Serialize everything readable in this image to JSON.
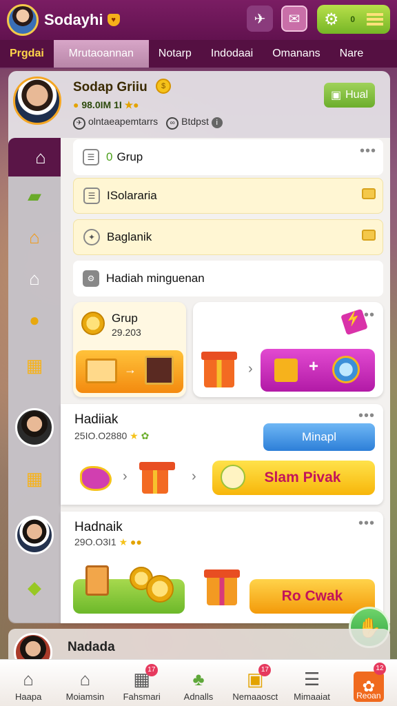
{
  "header": {
    "app_title": "Sodayhi",
    "settings_count": "0"
  },
  "tabs": [
    "Prgdai",
    "Mrutaoannan",
    "Notarp",
    "Indodaai",
    "Omanans",
    "Nare"
  ],
  "profile": {
    "name": "Sodap Griiu",
    "stats": "98.0IM 1I",
    "meta_left": "olntaeapemtarrs",
    "meta_right": "Btdpst",
    "hual_label": "Hual"
  },
  "rows": [
    {
      "label": "Grup",
      "prefix": "0"
    },
    {
      "label": "ISolararia"
    },
    {
      "label": "Baglanik"
    },
    {
      "label": "Hadiah minguenan"
    }
  ],
  "grup_card": {
    "title": "Grup",
    "value": "29.203"
  },
  "feed": [
    {
      "title": "Hadiiak",
      "stats": "25IO.O2880",
      "button": "Minapl",
      "action": "Slam Pivak"
    },
    {
      "title": "Hadnaik",
      "stats": "29O.O3I1",
      "action": "Ro Cwak"
    }
  ],
  "peek": {
    "name": "Nadada"
  },
  "bottom_nav": [
    {
      "label": "Haapa",
      "badge": ""
    },
    {
      "label": "Moiamsin",
      "badge": ""
    },
    {
      "label": "Fahsmari",
      "badge": "17"
    },
    {
      "label": "Adnalls",
      "badge": ""
    },
    {
      "label": "Nemaaosct",
      "badge": "17"
    },
    {
      "label": "Mimaaiat",
      "badge": ""
    },
    {
      "label": "Reoan",
      "badge": "12"
    }
  ]
}
